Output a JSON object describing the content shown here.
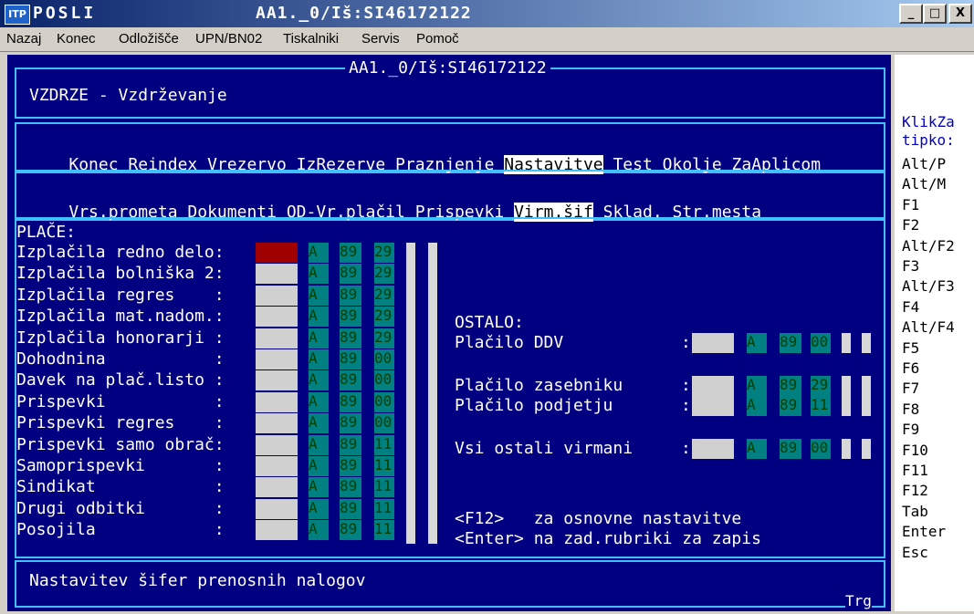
{
  "window": {
    "app_name": "POSLI",
    "title": "AA1._0/Iš:SI46172122",
    "app_icon": "ITP",
    "minimize": "_",
    "maximize": "□",
    "close": "X"
  },
  "menu": [
    "Nazaj",
    "Konec",
    "Odložišče",
    "UPN/BN02",
    "Tiskalniki",
    "Servis",
    "Pomoč"
  ],
  "console": {
    "frame_title": "AA1._0/Iš:SI46172122",
    "header": "VZDRZE - Vzdrževanje",
    "menu1": [
      "Konec",
      "Reindex",
      "Vrezervo",
      "IzRezerve",
      "Praznjenje",
      "Nastavitve",
      "Test",
      "Okolje",
      "ZaAplicom"
    ],
    "menu1_selected": "Nastavitve",
    "menu2": [
      "Vrs.prometa",
      "Dokumenti",
      "OD-Vr.plačil",
      "Prispevki",
      "Virm.šif",
      "Sklad.",
      "Str.mesta"
    ],
    "menu2_selected": "Virm.šif",
    "place_title": "PLAČE:",
    "place_rows": [
      {
        "label": "Izplačila redno delo:",
        "a": "A",
        "b": "89",
        "c": "29"
      },
      {
        "label": "Izplačila bolniška 2:",
        "a": "A",
        "b": "89",
        "c": "29"
      },
      {
        "label": "Izplačila regres    :",
        "a": "A",
        "b": "89",
        "c": "29"
      },
      {
        "label": "Izplačila mat.nadom.:",
        "a": "A",
        "b": "89",
        "c": "29"
      },
      {
        "label": "Izplačila honorarji :",
        "a": "A",
        "b": "89",
        "c": "29"
      },
      {
        "label": "Dohodnina           :",
        "a": "A",
        "b": "89",
        "c": "00"
      },
      {
        "label": "Davek na plač.listo :",
        "a": "A",
        "b": "89",
        "c": "00"
      },
      {
        "label": "Prispevki           :",
        "a": "A",
        "b": "89",
        "c": "00"
      },
      {
        "label": "Prispevki regres    :",
        "a": "A",
        "b": "89",
        "c": "00"
      },
      {
        "label": "Prispevki samo obrač:",
        "a": "A",
        "b": "89",
        "c": "11"
      },
      {
        "label": "Samoprispevki       :",
        "a": "A",
        "b": "89",
        "c": "11"
      },
      {
        "label": "Sindikat            :",
        "a": "A",
        "b": "89",
        "c": "11"
      },
      {
        "label": "Drugi odbitki       :",
        "a": "A",
        "b": "89",
        "c": "11"
      },
      {
        "label": "Posojila            :",
        "a": "A",
        "b": "89",
        "c": "11"
      }
    ],
    "ostalo_title": "OSTALO:",
    "ostalo_rows": [
      {
        "label": "Plačilo DDV",
        "colon": ":",
        "a": "A",
        "b": "89",
        "c": "00"
      },
      {
        "label": "Plačilo zasebniku",
        "colon": ":",
        "a": "A",
        "b": "89",
        "c": "29"
      },
      {
        "label": "Plačilo podjetju",
        "colon": ":",
        "a": "A",
        "b": "89",
        "c": "11"
      },
      {
        "label": "Vsi ostali virmani",
        "colon": ":",
        "a": "A",
        "b": "89",
        "c": "00"
      }
    ],
    "hint1": "<F12>   za osnovne nastavitve",
    "hint2": "<Enter> na zad.rubriki za zapis",
    "status": "Nastavitev šifer prenosnih nalogov",
    "corner": "Trg"
  },
  "keys": {
    "title1": "KlikZa",
    "title2": "tipko:",
    "list": [
      "Alt/P",
      "Alt/M",
      "F1",
      "F2",
      "Alt/F2",
      "F3",
      "Alt/F3",
      "F4",
      "Alt/F4",
      "F5",
      "F6",
      "F7",
      "F8",
      "F9",
      "F10",
      "F11",
      "F12",
      "Tab",
      "Enter",
      "Esc"
    ]
  },
  "colors": {
    "console_bg": "#000080",
    "frame": "#40c0ff",
    "badge": "#008080",
    "field": "#d0d0d0",
    "active_field": "#a00000"
  }
}
